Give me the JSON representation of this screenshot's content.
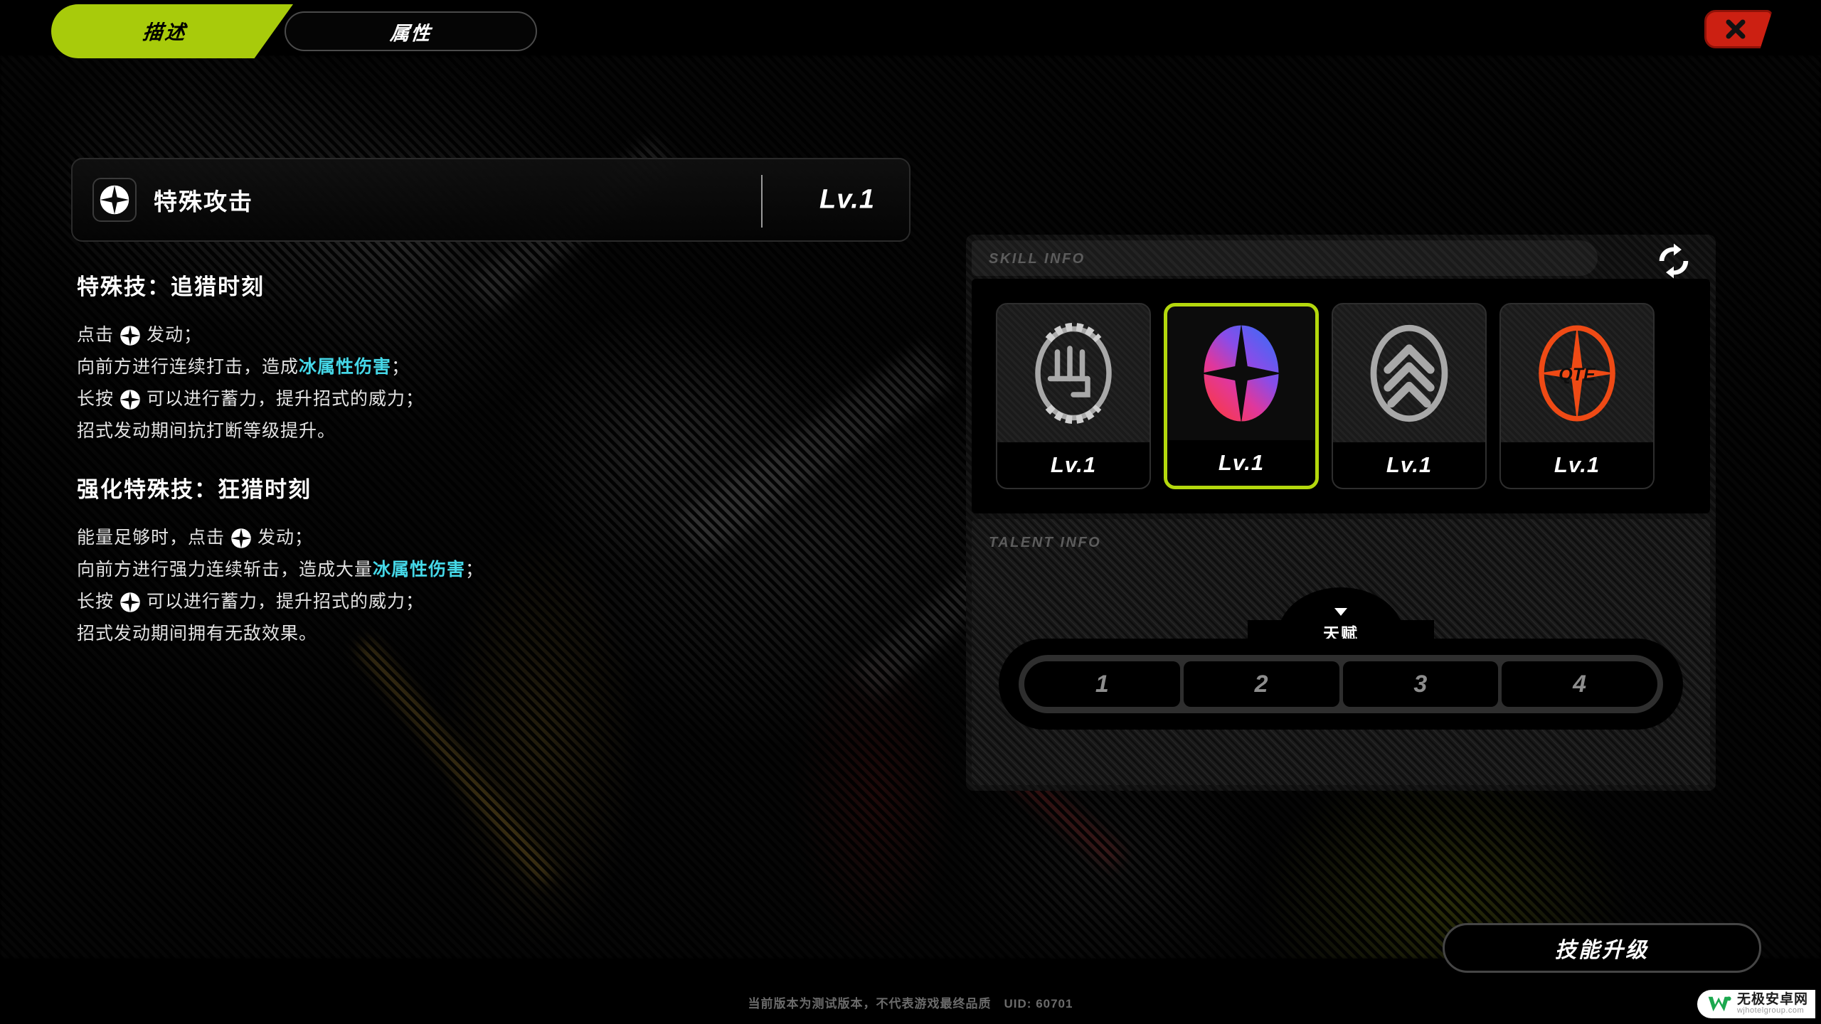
{
  "colors": {
    "accent_green": "#a8cb0b",
    "select_green": "#b4d80d",
    "close_red": "#cc2012",
    "element_cyan": "#45d8e8",
    "qte_orange": "#ef4a15",
    "panel_bg": "#0d0d0d"
  },
  "topbar": {
    "tabs": [
      {
        "label": "描述",
        "active": true
      },
      {
        "label": "属性",
        "active": false
      }
    ],
    "close_icon": "close-x-icon"
  },
  "skill_header": {
    "icon": "special-attack-star-icon",
    "name": "特殊攻击",
    "level": "Lv.1"
  },
  "description": {
    "blocks": [
      {
        "title": "特殊技：追猎时刻",
        "lines": [
          [
            {
              "t": "text",
              "v": "点击 "
            },
            {
              "t": "icon",
              "v": "special-attack-star-icon"
            },
            {
              "t": "text",
              "v": " 发动；"
            }
          ],
          [
            {
              "t": "text",
              "v": "向前方进行连续打击，造成"
            },
            {
              "t": "hl",
              "v": "冰属性伤害"
            },
            {
              "t": "text",
              "v": "；"
            }
          ],
          [
            {
              "t": "text",
              "v": "长按 "
            },
            {
              "t": "icon",
              "v": "special-attack-star-icon"
            },
            {
              "t": "text",
              "v": " 可以进行蓄力，提升招式的威力；"
            }
          ],
          [
            {
              "t": "text",
              "v": "招式发动期间抗打断等级提升。"
            }
          ]
        ]
      },
      {
        "title": "强化特殊技：狂猎时刻",
        "lines": [
          [
            {
              "t": "text",
              "v": "能量足够时，点击 "
            },
            {
              "t": "icon",
              "v": "special-attack-star-icon"
            },
            {
              "t": "text",
              "v": " 发动；"
            }
          ],
          [
            {
              "t": "text",
              "v": "向前方进行强力连续斩击，造成大量"
            },
            {
              "t": "hl",
              "v": "冰属性伤害"
            },
            {
              "t": "text",
              "v": "；"
            }
          ],
          [
            {
              "t": "text",
              "v": "长按 "
            },
            {
              "t": "icon",
              "v": "special-attack-star-icon"
            },
            {
              "t": "text",
              "v": " 可以进行蓄力，提升招式的威力；"
            }
          ],
          [
            {
              "t": "text",
              "v": "招式发动期间拥有无敌效果。"
            }
          ]
        ]
      }
    ]
  },
  "skill_info": {
    "label": "SKILL INFO",
    "refresh_icon": "refresh-swap-icon",
    "cards": [
      {
        "icon": "basic-attack-fist-icon",
        "level": "Lv.1",
        "selected": false
      },
      {
        "icon": "special-attack-star-icon",
        "level": "Lv.1",
        "selected": true
      },
      {
        "icon": "dodge-chevron-icon",
        "level": "Lv.1",
        "selected": false
      },
      {
        "icon": "qte-star-icon",
        "level": "Lv.1",
        "selected": false
      }
    ]
  },
  "talent_info": {
    "label": "TALENT INFO",
    "tab_label": "天赋",
    "caret_icon": "chevron-down-icon",
    "slots": [
      "1",
      "2",
      "3",
      "4"
    ]
  },
  "bottom": {
    "upgrade_label": "技能升级",
    "footer_note": "当前版本为测试版本，不代表游戏最终品质　UID: 60701"
  },
  "watermark": {
    "logo": "w-logo-icon",
    "name": "无极安卓网",
    "url": "wjhotelgroup.com"
  }
}
